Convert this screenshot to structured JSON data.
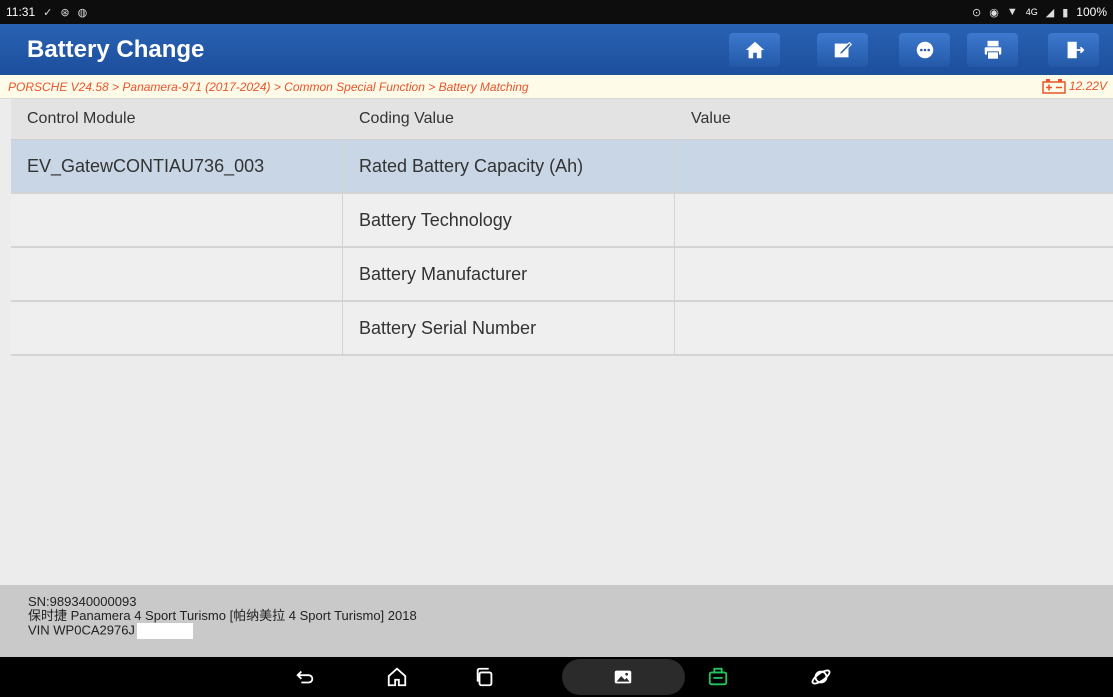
{
  "status": {
    "time": "11:31",
    "left_icons": [
      "vpn-icon",
      "app-icon",
      "chat-icon"
    ],
    "right_text": "4G",
    "battery": "100%"
  },
  "header": {
    "title": "Battery Change",
    "buttons": [
      "home",
      "edit",
      "feedback",
      "print",
      "exit"
    ]
  },
  "breadcrumb": {
    "path": "PORSCHE V24.58 > Panamera-971 (2017-2024) > Common Special Function > Battery Matching",
    "voltage": "12.22V"
  },
  "table": {
    "columns": [
      "Control Module",
      "Coding Value",
      "Value"
    ],
    "rows": [
      {
        "module": "EV_GatewCONTIAU736_003",
        "coding": "Rated Battery Capacity (Ah)",
        "value": "",
        "selected": true
      },
      {
        "module": "",
        "coding": "Battery Technology",
        "value": ""
      },
      {
        "module": "",
        "coding": "Battery Manufacturer",
        "value": ""
      },
      {
        "module": "",
        "coding": "Battery Serial Number",
        "value": ""
      }
    ]
  },
  "info": {
    "sn": "SN:989340000093",
    "vehicle": "保时捷 Panamera 4 Sport Turismo [帕纳美拉 4 Sport Turismo] 2018",
    "vin": "VIN WP0CA2976J"
  },
  "colors": {
    "titlebar": "#1c4f9c",
    "breadcrumb_text": "#e9542b",
    "selected_row": "#c9d6e5"
  }
}
